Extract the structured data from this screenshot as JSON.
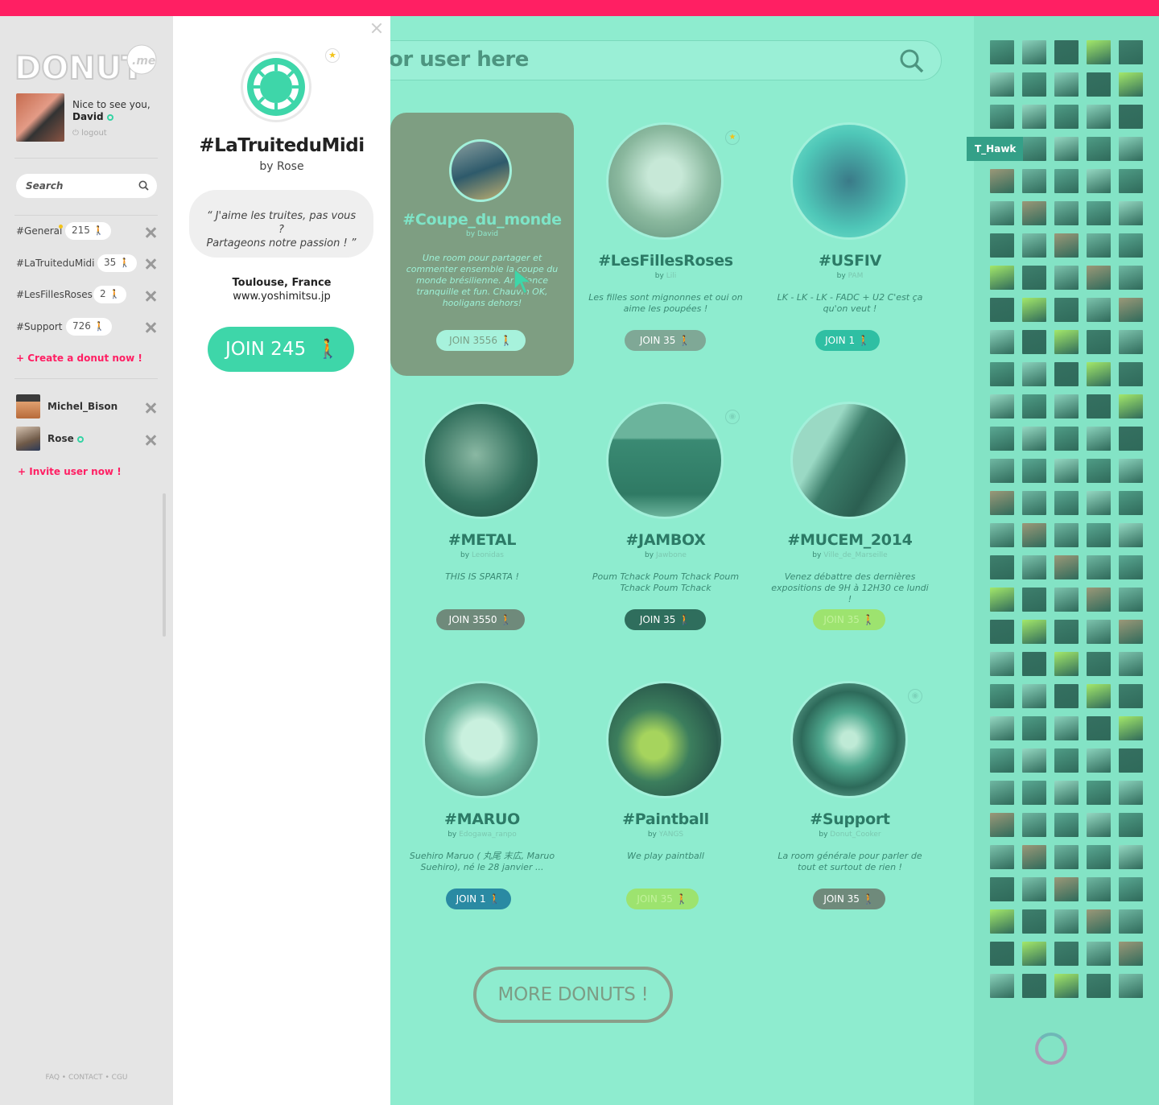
{
  "app": {
    "logo_text": "DONUT",
    "logo_suffix": ".me"
  },
  "profile": {
    "greeting": "Nice to see you,",
    "name": "David",
    "logout": "logout"
  },
  "sidebar": {
    "search_placeholder": "Search",
    "rooms": [
      {
        "name": "#General",
        "count": "215",
        "has_notification": true
      },
      {
        "name": "#LaTruiteduMidi",
        "count": "35"
      },
      {
        "name": "#LesFillesRoses",
        "count": "2"
      },
      {
        "name": "#Support",
        "count": "726"
      }
    ],
    "create_label": "+ Create a donut now !",
    "users": [
      {
        "name": "Michel_Bison",
        "online": false
      },
      {
        "name": "Rose",
        "online": true
      }
    ],
    "invite_label": "+ Invite user now !",
    "footer": "FAQ • CONTACT • CGU"
  },
  "detail": {
    "title": "#LaTruiteduMidi",
    "by": "by Rose",
    "quote_line1": "“ J'aime les truites, pas vous ?",
    "quote_line2": "Partageons notre passion ! ”",
    "location": "Toulouse, France",
    "url": "www.yoshimitsu.jp",
    "join_label": "JOIN 245"
  },
  "main": {
    "search_text": "or user here",
    "cards": [
      {
        "title": "#Coupe_du_monde",
        "by_prefix": "by",
        "owner": "David",
        "desc": "Une room pour partager et commenter ensemble la coupe du monde brésilienne. Ambiance tranquille et fun. Chauvin OK, hooligans dehors!",
        "join": "JOIN 3556"
      },
      {
        "title": "#LesFillesRoses",
        "by_prefix": "by",
        "owner": "Lili",
        "desc": "Les filles sont mignonnes et oui on aime les poupées !",
        "join": "JOIN 35"
      },
      {
        "title": "#USFIV",
        "by_prefix": "by",
        "owner": "PAM",
        "desc": "LK - LK - LK - FADC + U2 C'est ça qu'on veut !",
        "join": "JOIN 1"
      },
      {
        "title": "#METAL",
        "by_prefix": "by",
        "owner": "Leonidas",
        "desc": "THIS IS SPARTA !",
        "join": "JOIN 3550"
      },
      {
        "title": "#JAMBOX",
        "by_prefix": "by",
        "owner": "Jawbone",
        "desc": "Poum Tchack Poum Tchack Poum Tchack Poum Tchack",
        "join": "JOIN 35"
      },
      {
        "title": "#MUCEM_2014",
        "by_prefix": "by",
        "owner": "Ville_de_Marseille",
        "desc": "Venez débattre des dernières expositions de 9H à 12H30 ce lundi !",
        "join": "JOIN 35"
      },
      {
        "title": "#MARUO",
        "by_prefix": "by",
        "owner": "Edogawa_ranpo",
        "desc": "Suehiro Maruo ( 丸尾 末広, Maruo Suehiro), né le 28 janvier ...",
        "join": "JOIN 1"
      },
      {
        "title": "#Paintball",
        "by_prefix": "by",
        "owner": "YANGS",
        "desc": "We play paintball",
        "join": "JOIN 35"
      },
      {
        "title": "#Support",
        "by_prefix": "by",
        "owner": "Donut_Cooker",
        "desc": "La room générale pour parler de tout et surtout de rien !",
        "join": "JOIN 35"
      }
    ],
    "more_label": "MORE DONUTS !"
  },
  "online_users": {
    "tooltip": "T_Hawk"
  },
  "colors": {
    "accent": "#ff1f63",
    "brand_green": "#3ed6a9",
    "background": "#8eeccf"
  }
}
